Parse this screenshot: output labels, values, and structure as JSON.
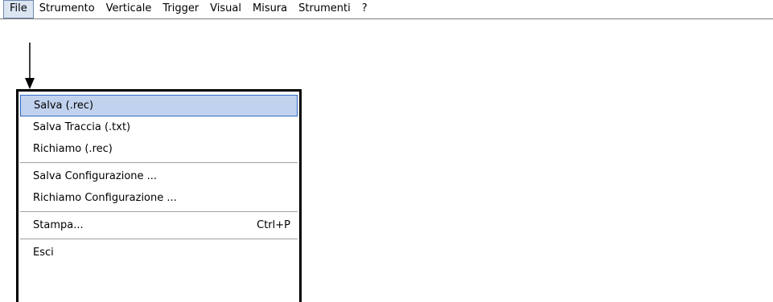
{
  "menubar": {
    "items": [
      "File",
      "Strumento",
      "Verticale",
      "Trigger",
      "Visual",
      "Misura",
      "Strumenti",
      "?"
    ]
  },
  "file_menu": {
    "groups": [
      [
        {
          "label": "Salva (.rec)",
          "shortcut": ""
        },
        {
          "label": "Salva Traccia (.txt)",
          "shortcut": ""
        },
        {
          "label": "Richiamo (.rec)",
          "shortcut": ""
        }
      ],
      [
        {
          "label": "Salva Configurazione ...",
          "shortcut": ""
        },
        {
          "label": "Richiamo Configurazione ...",
          "shortcut": ""
        }
      ],
      [
        {
          "label": "Stampa...",
          "shortcut": "Ctrl+P"
        }
      ],
      [
        {
          "label": "Esci",
          "shortcut": ""
        }
      ]
    ]
  },
  "colors": {
    "highlight_bg": "#c1d2ee",
    "highlight_border": "#316ac5"
  }
}
